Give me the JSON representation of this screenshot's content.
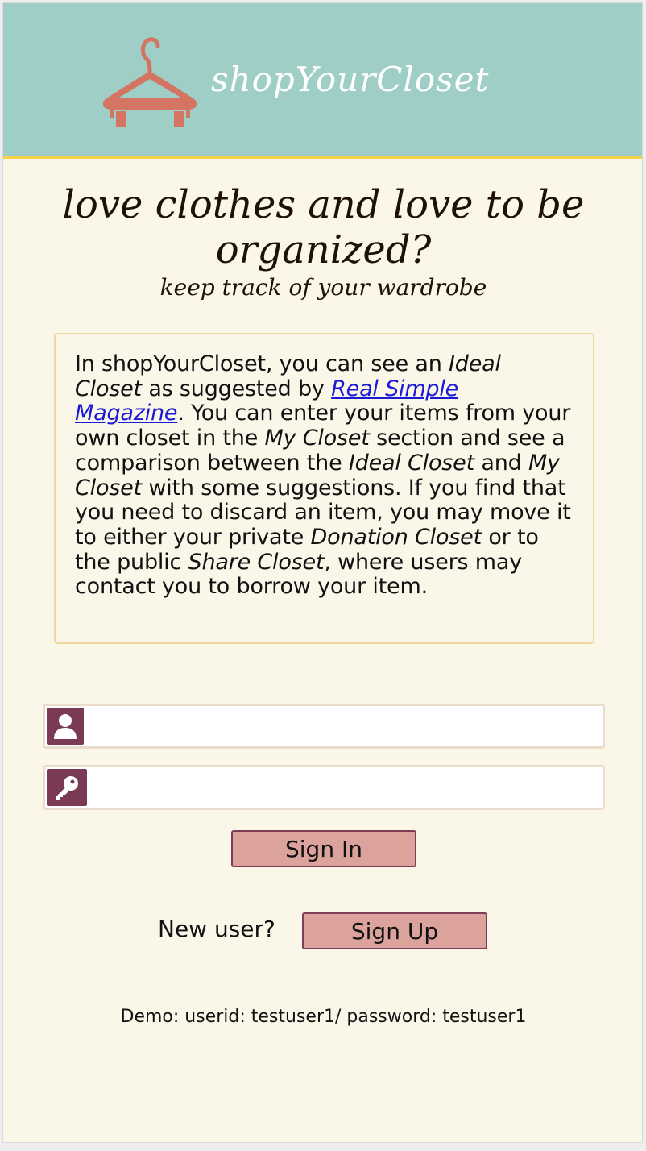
{
  "header": {
    "brand": "shopYourCloset",
    "logo_icon": "hanger-icon",
    "colors": {
      "header_bg": "#9ecec6",
      "header_border": "#f2d24a",
      "hanger": "#d47462"
    }
  },
  "hero": {
    "headline": "love clothes and love to be organized?",
    "subheadline": "keep track of your wardrobe"
  },
  "intro": {
    "p1": "In shopYourCloset, you can see an ",
    "ideal_closet_1": "Ideal Closet",
    "p2": " as suggested by ",
    "link_text": "Real Simple Magazine",
    "p3": ". You can enter your items from your own closet in the ",
    "my_closet_1": "My Closet",
    "p4": " section and see a comparison between the ",
    "ideal_closet_2": "Ideal Closet",
    "p5": " and ",
    "my_closet_2": "My Closet",
    "p6": " with some suggestions. If you find that you need to discard an item, you may move it to either your private ",
    "donation_closet": "Donation Closet",
    "p7": " or to the public ",
    "share_closet": "Share Closet",
    "p8": ", where users may contact you to borrow your item."
  },
  "login": {
    "userid": {
      "icon": "user-icon",
      "value": "",
      "placeholder": ""
    },
    "password": {
      "icon": "key-icon",
      "value": "",
      "placeholder": ""
    },
    "signin_label": "Sign In",
    "new_user_label": "New user?",
    "signup_label": "Sign Up"
  },
  "demo_note": "Demo: userid: testuser1/ password: testuser1",
  "colors": {
    "page_bg": "#faf6e8",
    "accent_plum": "#7a3a55",
    "button_bg": "#dba39c",
    "intro_border": "#f0d9a0"
  }
}
